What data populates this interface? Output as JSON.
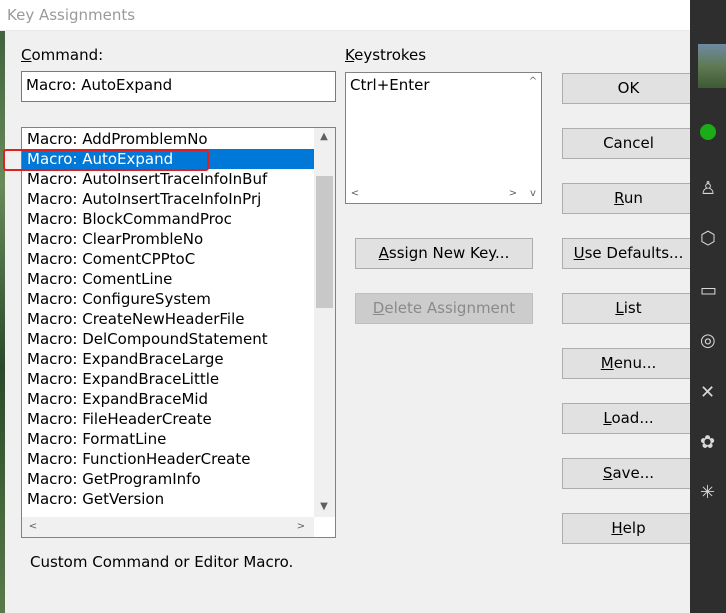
{
  "window": {
    "title": "Key Assignments"
  },
  "command": {
    "label": "Command:",
    "value": "Macro: AutoExpand"
  },
  "keystrokes": {
    "label": "Keystrokes",
    "items": [
      "Ctrl+Enter"
    ]
  },
  "command_list": {
    "items": [
      "Macro: AddPromblemNo",
      "Macro: AutoExpand",
      "Macro: AutoInsertTraceInfoInBuf",
      "Macro: AutoInsertTraceInfoInPrj",
      "Macro: BlockCommandProc",
      "Macro: ClearPrombleNo",
      "Macro: ComentCPPtoC",
      "Macro: ComentLine",
      "Macro: ConfigureSystem",
      "Macro: CreateNewHeaderFile",
      "Macro: DelCompoundStatement",
      "Macro: ExpandBraceLarge",
      "Macro: ExpandBraceLittle",
      "Macro: ExpandBraceMid",
      "Macro: FileHeaderCreate",
      "Macro: FormatLine",
      "Macro: FunctionHeaderCreate",
      "Macro: GetProgramInfo",
      "Macro: GetVersion"
    ],
    "selected_index": 1
  },
  "buttons": {
    "assign_new_key": "Assign New Key...",
    "delete_assignment": "Delete Assignment",
    "ok": "OK",
    "cancel": "Cancel",
    "run": "Run",
    "use_defaults": "Use Defaults...",
    "list": "List",
    "menu": "Menu...",
    "load": "Load...",
    "save": "Save...",
    "help": "Help"
  },
  "status": {
    "description": "Custom Command or Editor Macro."
  },
  "colors": {
    "selection": "#0078d7",
    "highlight_outline": "#e02020"
  },
  "icons": {
    "scroll_up": "▲",
    "scroll_down": "▼",
    "scroll_left": "<",
    "scroll_right": ">",
    "keystroke_scroll_up": "^",
    "keystroke_scroll_down": "v"
  }
}
